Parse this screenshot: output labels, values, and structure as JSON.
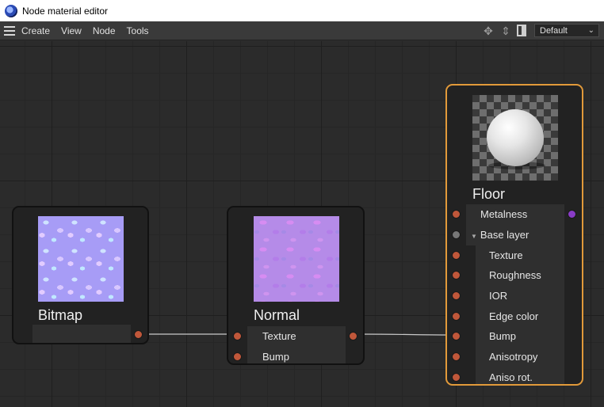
{
  "window": {
    "title": "Node material editor"
  },
  "menubar": {
    "items": [
      "Create",
      "View",
      "Node",
      "Tools"
    ],
    "layout_select": "Default"
  },
  "nodes": {
    "bitmap": {
      "name": "Bitmap"
    },
    "normal": {
      "name": "Normal",
      "inputs": [
        "Texture",
        "Bump"
      ]
    },
    "floor": {
      "name": "Floor",
      "rows": [
        "Metalness",
        "Base layer",
        "Texture",
        "Roughness",
        "IOR",
        "Edge color",
        "Bump",
        "Anisotropy",
        "Aniso rot."
      ]
    }
  },
  "colors": {
    "selected_border": "#e29a3a",
    "port": "#c0573a",
    "port_gray": "#777777",
    "port_purple": "#8a3cc7"
  }
}
